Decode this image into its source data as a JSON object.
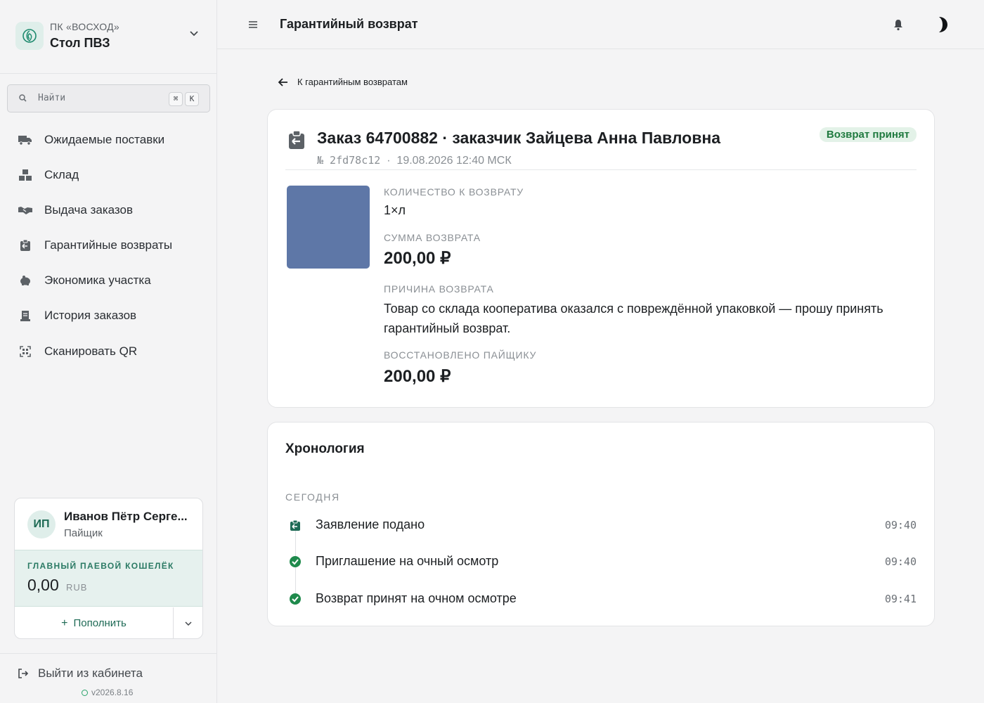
{
  "sidebar": {
    "org": "ПК «ВОСХОД»",
    "workspace": "Стол ПВЗ",
    "search": {
      "placeholder": "Найти",
      "shortcut_mod": "⌘",
      "shortcut_key": "K"
    },
    "nav": [
      {
        "label": "Ожидаемые поставки",
        "icon": "truck-icon"
      },
      {
        "label": "Склад",
        "icon": "boxes-icon"
      },
      {
        "label": "Выдача заказов",
        "icon": "handshake-icon"
      },
      {
        "label": "Гарантийные возвраты",
        "icon": "clipboard-return-icon"
      },
      {
        "label": "Экономика участка",
        "icon": "piggy-bank-icon"
      },
      {
        "label": "История заказов",
        "icon": "receipt-icon"
      },
      {
        "label": "Сканировать QR",
        "icon": "qr-code-icon"
      }
    ],
    "user": {
      "initials": "ИП",
      "name": "Иванов Пётр Серге...",
      "role": "Пайщик"
    },
    "wallet": {
      "label": "ГЛАВНЫЙ ПАЕВОЙ КОШЕЛЁК",
      "amount": "0,00",
      "currency": "RUB"
    },
    "topup_label": "Пополнить",
    "logout_label": "Выйти из кабинета",
    "version": "v2026.8.16"
  },
  "header": {
    "title": "Гарантийный возврат"
  },
  "main": {
    "back_label": "К гарантийным возвратам",
    "order": {
      "title": "Заказ 64700882 · заказчик Зайцева Анна Павловна",
      "number": "№ 2fd78c12",
      "separator": "·",
      "datetime": "19.08.2026 12:40 МСК",
      "status": "Возврат принят",
      "quantity_label": "КОЛИЧЕСТВО К ВОЗВРАТУ",
      "quantity_value": "1×л",
      "amount_label": "СУММА ВОЗВРАТА",
      "amount_value": "200,00 ₽",
      "reason_label": "ПРИЧИНА ВОЗВРАТА",
      "reason_value": "Товар со склада кооператива оказался с повреждённой упаковкой — прошу принять гарантийный возврат.",
      "restored_label": "ВОССТАНОВЛЕНО ПАЙЩИКУ",
      "restored_value": "200,00 ₽"
    },
    "timeline": {
      "title": "Хронология",
      "day": "СЕГОДНЯ",
      "events": [
        {
          "label": "Заявление подано",
          "time": "09:40",
          "icon": "clipboard-return-icon"
        },
        {
          "label": "Приглашение на очный осмотр",
          "time": "09:40",
          "icon": "check-circle-icon"
        },
        {
          "label": "Возврат принят на очном осмотре",
          "time": "09:41",
          "icon": "check-circle-icon"
        }
      ]
    }
  },
  "colors": {
    "accent": "#1e6a55",
    "status_success": "#1f7a3f",
    "product_swatch": "#5e77a7"
  }
}
